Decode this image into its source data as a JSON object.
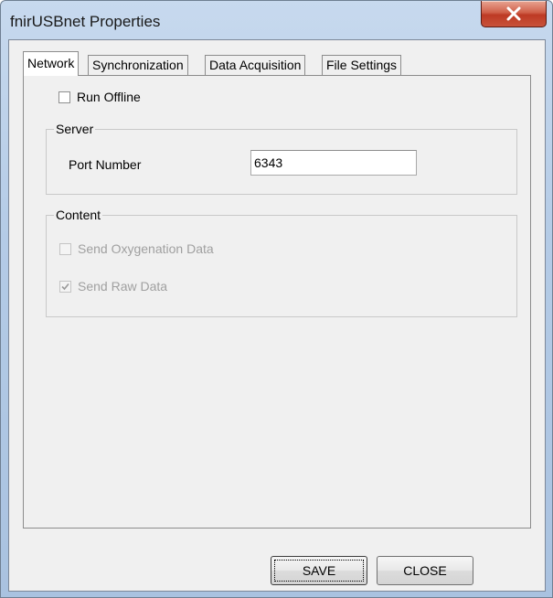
{
  "window": {
    "title": "fnirUSBnet Properties"
  },
  "tabs": [
    {
      "label": "Network",
      "active": true
    },
    {
      "label": "Synchronization",
      "active": false
    },
    {
      "label": "Data Acquisition",
      "active": false
    },
    {
      "label": "File Settings",
      "active": false
    }
  ],
  "network": {
    "run_offline": {
      "label": "Run Offline",
      "checked": false
    },
    "server": {
      "group_title": "Server",
      "port_label": "Port Number",
      "port_value": "6343"
    },
    "content": {
      "group_title": "Content",
      "send_oxygenation": {
        "label": "Send Oxygenation Data",
        "checked": false,
        "enabled": false
      },
      "send_raw": {
        "label": "Send Raw Data",
        "checked": true,
        "enabled": false
      }
    }
  },
  "buttons": {
    "save": "SAVE",
    "close": "CLOSE"
  },
  "icons": {
    "close": "close-x-icon",
    "check": "check-icon"
  },
  "colors": {
    "close_button": "#c8523a",
    "disabled_text": "#a0a0a0",
    "dialog_bg": "#f0f0f0"
  }
}
